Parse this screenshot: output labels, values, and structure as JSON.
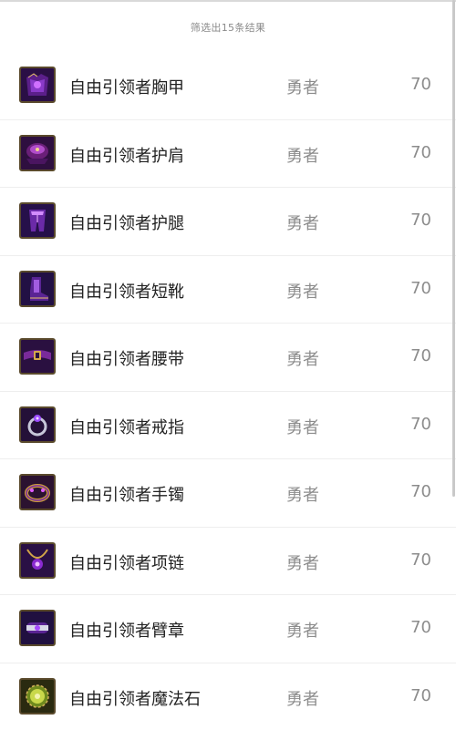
{
  "header": {
    "result_summary": "筛选出15条结果"
  },
  "items": [
    {
      "name": "自由引领者胸甲",
      "class": "勇者",
      "level": "70",
      "icon": "chest-armor-icon"
    },
    {
      "name": "自由引领者护肩",
      "class": "勇者",
      "level": "70",
      "icon": "shoulder-armor-icon"
    },
    {
      "name": "自由引领者护腿",
      "class": "勇者",
      "level": "70",
      "icon": "leg-armor-icon"
    },
    {
      "name": "自由引领者短靴",
      "class": "勇者",
      "level": "70",
      "icon": "boots-icon"
    },
    {
      "name": "自由引领者腰带",
      "class": "勇者",
      "level": "70",
      "icon": "belt-icon"
    },
    {
      "name": "自由引领者戒指",
      "class": "勇者",
      "level": "70",
      "icon": "ring-icon"
    },
    {
      "name": "自由引领者手镯",
      "class": "勇者",
      "level": "70",
      "icon": "bracelet-icon"
    },
    {
      "name": "自由引领者项链",
      "class": "勇者",
      "level": "70",
      "icon": "necklace-icon"
    },
    {
      "name": "自由引领者臂章",
      "class": "勇者",
      "level": "70",
      "icon": "armband-icon"
    },
    {
      "name": "自由引领者魔法石",
      "class": "勇者",
      "level": "70",
      "icon": "magic-stone-icon"
    }
  ],
  "colors": {
    "icon_bg_purple": "#3a1860",
    "icon_glow": "#b04cff",
    "icon_gold": "#c9a24a",
    "magic_stone_green": "#6f8a1e"
  }
}
